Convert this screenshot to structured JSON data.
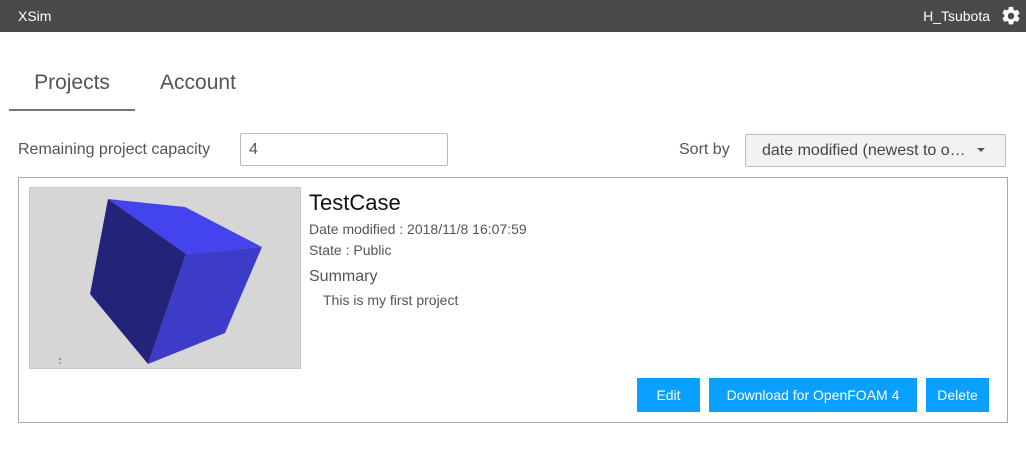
{
  "header": {
    "app_title": "XSim",
    "username": "H_Tsubota",
    "settings_icon": "gear-icon"
  },
  "tabs": [
    {
      "label": "Projects",
      "active": true
    },
    {
      "label": "Account",
      "active": false
    }
  ],
  "capacity": {
    "label": "Remaining project capacity",
    "value": "4"
  },
  "sort": {
    "label": "Sort by",
    "value": "date modified (newest to oldest)"
  },
  "project": {
    "name": "TestCase",
    "date_modified": "Date modified : 2018/11/8 16:07:59",
    "state": "State : Public",
    "summary_heading": "Summary",
    "summary_text": "This is my first project",
    "thumbnail_color": "#3b3bdd"
  },
  "buttons": {
    "edit": "Edit",
    "download": "Download for OpenFOAM 4",
    "delete": "Delete"
  },
  "colors": {
    "topbar": "#4a4a4a",
    "accent": "#0aa0ff"
  }
}
